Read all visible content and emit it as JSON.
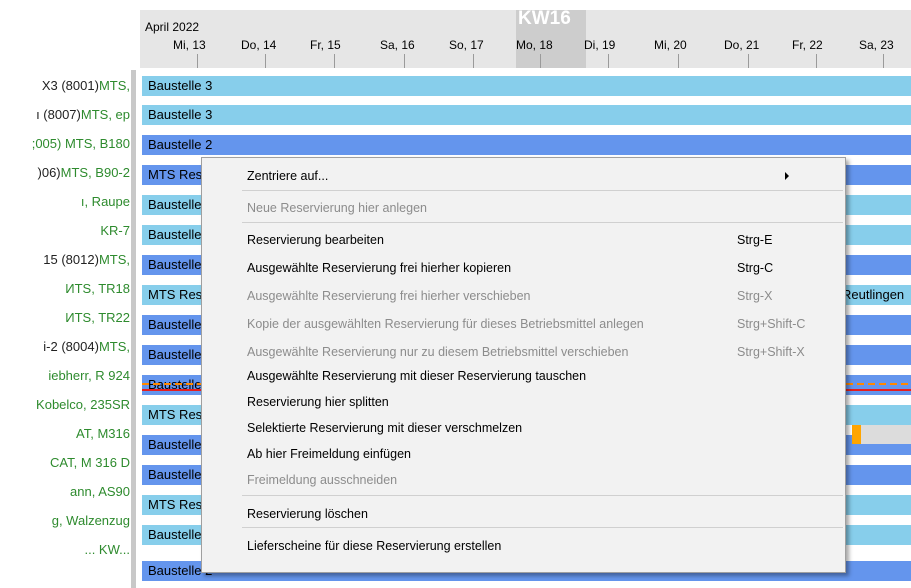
{
  "timeline": {
    "month": "April 2022",
    "week": "KW16",
    "days": [
      "Mi, 13",
      "Do, 14",
      "Fr, 15",
      "Sa, 16",
      "So, 17",
      "Mo, 18",
      "Di, 19",
      "Mi, 20",
      "Do, 21",
      "Fr, 22",
      "Sa, 23"
    ]
  },
  "resources": [
    {
      "dark": "X3 (8001) ",
      "green": "MTS,"
    },
    {
      "dark": "ı (8007) ",
      "green": "MTS, ep"
    },
    {
      "dark": "",
      "green": ";005) MTS, B180"
    },
    {
      "dark": ")06) ",
      "green": "MTS, B90-2"
    },
    {
      "dark": "",
      "green": "ı, Raupe"
    },
    {
      "dark": "",
      "green": " KR-7"
    },
    {
      "dark": "15 (8012) ",
      "green": "MTS,"
    },
    {
      "dark": "",
      "green": "ИTS, TR18"
    },
    {
      "dark": "",
      "green": "ИTS, TR22"
    },
    {
      "dark": "i-2 (8004) ",
      "green": "MTS,"
    },
    {
      "dark": "",
      "green": "iebherr, R 924"
    },
    {
      "dark": "",
      "green": " Kobelco, 235SR"
    },
    {
      "dark": "",
      "green": "AT, M316"
    },
    {
      "dark": "",
      "green": "CAT, M 316 D"
    },
    {
      "dark": "",
      "green": "ann, AS90"
    },
    {
      "dark": "",
      "green": "g, Walzenzug"
    },
    {
      "dark": "",
      "green": "... KW..."
    }
  ],
  "bars": [
    {
      "label": "Baustelle 3"
    },
    {
      "label": "Baustelle 3"
    },
    {
      "label": "Baustelle 2"
    },
    {
      "label": "MTS Reservierung"
    },
    {
      "label": "Baustelle"
    },
    {
      "label": "Baustelle"
    },
    {
      "label": "Baustelle"
    },
    {
      "label": "MTS Reservierung",
      "right_label": "Reutlingen"
    },
    {
      "label": "Baustelle"
    },
    {
      "label": "Baustelle"
    },
    {
      "label": "Baustelle"
    },
    {
      "label": "MTS Reservierung"
    },
    {
      "label": "Baustelle"
    },
    {
      "label": "Baustelle"
    },
    {
      "label": "MTS Reservierung"
    },
    {
      "label": "Baustelle 3"
    },
    {
      "label": "Baustelle 2"
    }
  ],
  "context_menu": {
    "items": [
      {
        "label": "Zentriere auf...",
        "shortcut": "",
        "enabled": true,
        "has_submenu": true
      },
      {
        "label": "Neue Reservierung hier anlegen",
        "shortcut": "",
        "enabled": false
      },
      {
        "label": "Reservierung bearbeiten",
        "shortcut": "Strg-E",
        "enabled": true
      },
      {
        "label": "Ausgewählte Reservierung frei hierher kopieren",
        "shortcut": "Strg-C",
        "enabled": true
      },
      {
        "label": "Ausgewählte Reservierung frei hierher verschieben",
        "shortcut": "Strg-X",
        "enabled": false
      },
      {
        "label": "Kopie der ausgewählten Reservierung für dieses Betriebsmittel anlegen",
        "shortcut": "Strg+Shift-C",
        "enabled": false
      },
      {
        "label": "Ausgewählte Reservierung nur zu diesem Betriebsmittel verschieben",
        "shortcut": "Strg+Shift-X",
        "enabled": false
      },
      {
        "label": "Ausgewählte Reservierung mit dieser Reservierung tauschen",
        "shortcut": "",
        "enabled": true
      },
      {
        "label": "Reservierung hier splitten",
        "shortcut": "",
        "enabled": true
      },
      {
        "label": "Selektierte Reservierung mit dieser verschmelzen",
        "shortcut": "",
        "enabled": true
      },
      {
        "label": "Ab hier Freimeldung einfügen",
        "shortcut": "",
        "enabled": true
      },
      {
        "label": "Freimeldung ausschneiden",
        "shortcut": "",
        "enabled": false
      },
      {
        "label": "Reservierung löschen",
        "shortcut": "",
        "enabled": true
      },
      {
        "label": "Lieferscheine für diese Reservierung erstellen",
        "shortcut": "",
        "enabled": true
      }
    ]
  },
  "colors": {
    "bar_light": "#87ceeb",
    "bar_dark": "#6495ed",
    "resource_green": "#2e8b2e",
    "highlight_red": "#e61e1e"
  }
}
